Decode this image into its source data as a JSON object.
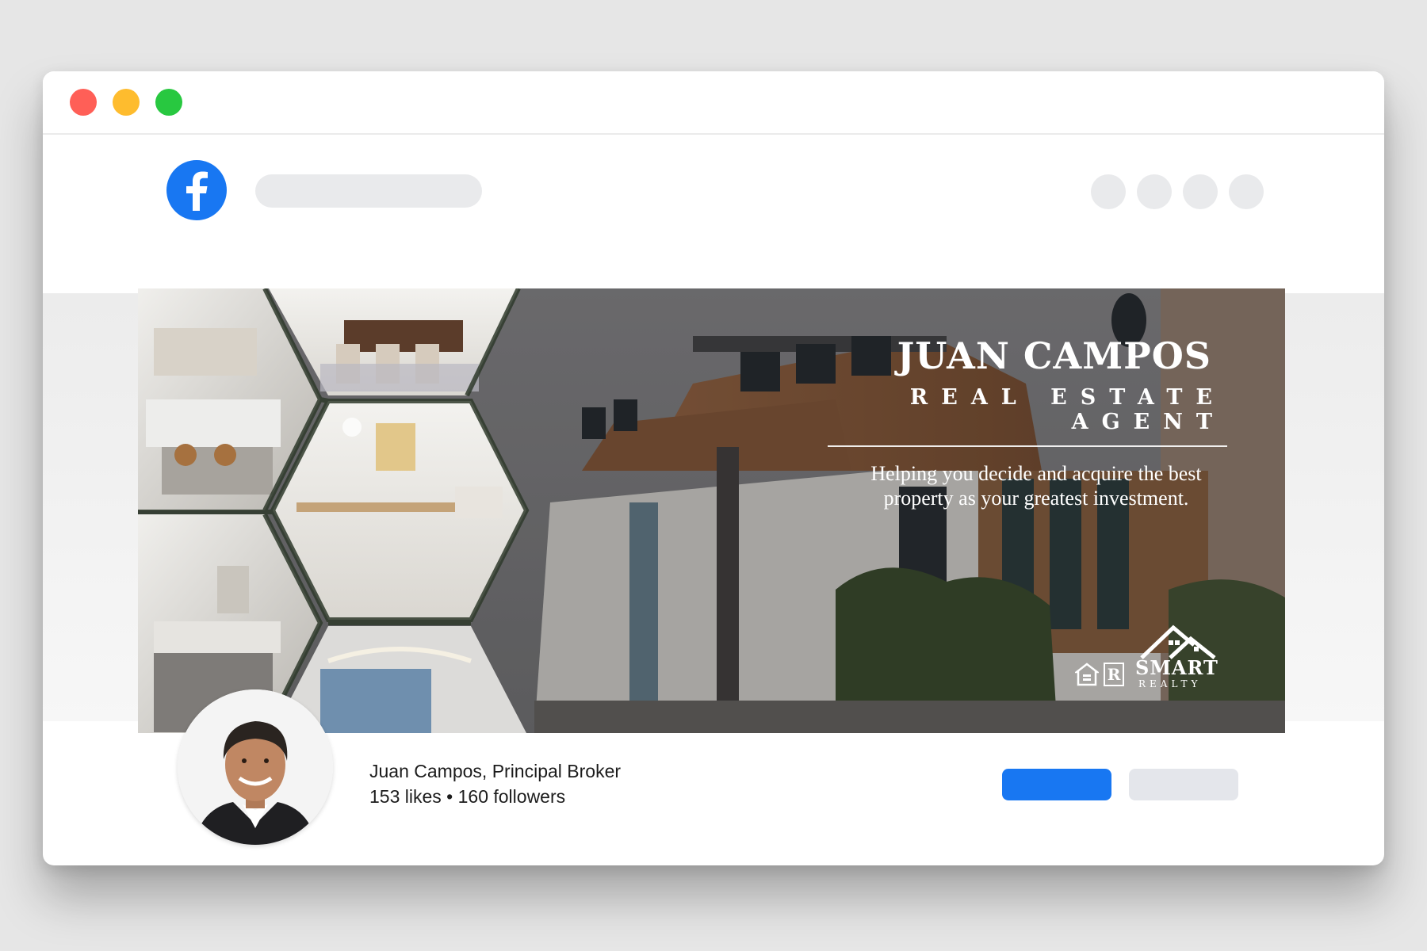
{
  "window": {
    "controls": [
      "close",
      "minimize",
      "maximize"
    ]
  },
  "navbar": {
    "logo_icon": "facebook-icon",
    "nav_placeholders": 4
  },
  "cover": {
    "name": "JUAN CAMPOS",
    "title": "REAL ESTATE AGENT",
    "tagline_line1": "Helping you decide and acquire the best",
    "tagline_line2": "property as your greatest investment.",
    "logo": {
      "brand": "SMART",
      "sub": "REALTY",
      "badges": [
        "equal-housing-icon",
        "realtor-icon"
      ]
    },
    "photos": [
      "kitchen-photo",
      "dining-photo",
      "living-room-photo",
      "kitchen-island-photo",
      "bedroom-photo",
      "house-exterior-photo"
    ]
  },
  "profile": {
    "name": "Juan Campos, Principal Broker",
    "stats": "153 likes • 160 followers"
  },
  "colors": {
    "facebook_blue": "#1877f2",
    "placeholder_gray": "#e9eaec",
    "dot_red": "#ff5f57",
    "dot_yellow": "#febc2e",
    "dot_green": "#28c840"
  }
}
